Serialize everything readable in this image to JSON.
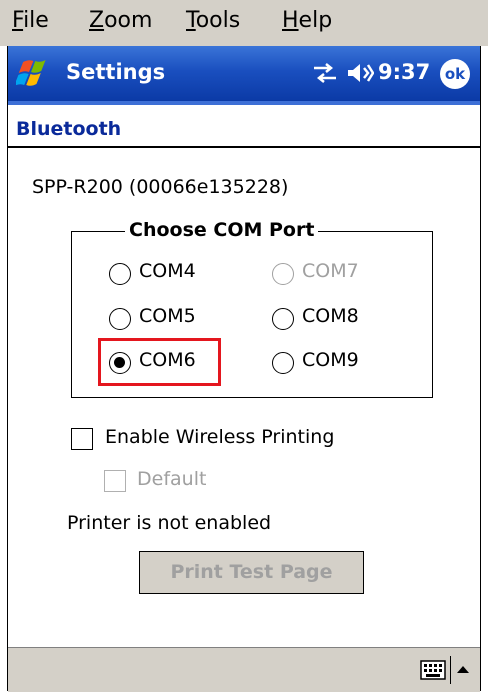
{
  "menubar": {
    "items": [
      {
        "first": "F",
        "rest": "ile"
      },
      {
        "first": "Z",
        "rest": "oom"
      },
      {
        "first": "T",
        "rest": "ools"
      },
      {
        "first": "H",
        "rest": "elp"
      }
    ]
  },
  "titlebar": {
    "title": "Settings",
    "time": "9:37",
    "ok_label": "ok",
    "icons": [
      "windows-start-icon",
      "connectivity-icon",
      "speaker-icon"
    ]
  },
  "page": {
    "subtitle": "Bluetooth",
    "device_name": "SPP-R200 (00066e135228)"
  },
  "com_group": {
    "legend": "Choose COM Port",
    "ports": [
      {
        "label": "COM4",
        "selected": false,
        "enabled": true
      },
      {
        "label": "COM7",
        "selected": false,
        "enabled": false
      },
      {
        "label": "COM5",
        "selected": false,
        "enabled": true
      },
      {
        "label": "COM8",
        "selected": false,
        "enabled": true
      },
      {
        "label": "COM6",
        "selected": true,
        "enabled": true
      },
      {
        "label": "COM9",
        "selected": false,
        "enabled": true
      }
    ]
  },
  "options": {
    "wireless_label": "Enable Wireless Printing",
    "wireless_checked": false,
    "default_label": "Default",
    "default_checked": false,
    "default_enabled": false,
    "status": "Printer is not enabled",
    "test_button": "Print Test Page"
  },
  "colors": {
    "titlebar": "#1a4fbf",
    "highlight": "#e4161e",
    "subtitle": "#0a2a9a",
    "chrome": "#d4d0c8"
  }
}
